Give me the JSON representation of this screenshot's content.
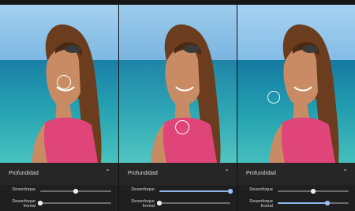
{
  "panels": [
    {
      "section_title": "Profundidad",
      "collapse_icon": "chevron-up-icon",
      "sliders": [
        {
          "label": "Desenfoque",
          "value": 0.5,
          "accent": false
        },
        {
          "label": "Desenfoque frontal",
          "value": 0.0,
          "accent": false
        }
      ],
      "focus_point": "face"
    },
    {
      "section_title": "Profundidad",
      "collapse_icon": "chevron-up-icon",
      "sliders": [
        {
          "label": "Desenfoque",
          "value": 1.0,
          "accent": true
        },
        {
          "label": "Desenfoque frontal",
          "value": 0.0,
          "accent": false
        }
      ],
      "focus_point": "shoulder"
    },
    {
      "section_title": "Profundidad",
      "collapse_icon": "chevron-up-icon",
      "sliders": [
        {
          "label": "Desenfoque",
          "value": 0.5,
          "accent": false
        },
        {
          "label": "Desenfoque frontal",
          "value": 0.7,
          "accent": true
        }
      ],
      "focus_point": "sea"
    }
  ],
  "colors": {
    "accent": "#8db4ea",
    "panel_bg": "#1f1f1f",
    "sky": "#8ec3ea",
    "sea": "#1f96a8",
    "top": "#e0457a"
  }
}
